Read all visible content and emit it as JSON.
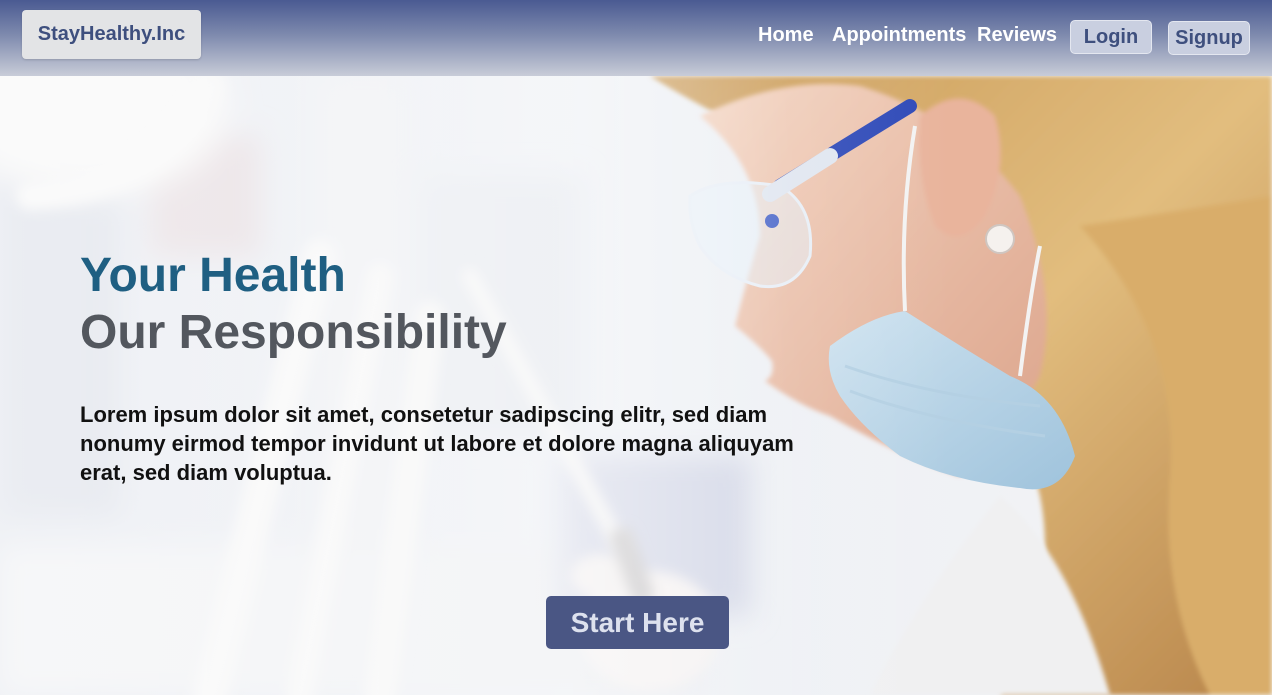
{
  "brand": {
    "name": "StayHealthy.Inc"
  },
  "nav": {
    "home": "Home",
    "appointments": "Appointments",
    "reviews": "Reviews",
    "login": "Login",
    "signup": "Signup"
  },
  "hero": {
    "headline_line1": "Your Health",
    "headline_line2": "Our Responsibility",
    "intro": "Lorem ipsum dolor sit amet, consetetur sadipscing elitr, sed diam nonumy eirmod tempor invidunt ut labore et dolore magna aliquyam erat, sed diam voluptua.",
    "cta_label": "Start Here",
    "photo_subject": "dentist-with-mask-and-goggles"
  },
  "colors": {
    "nav_gradient_top": "#4a5a92",
    "brand_text": "#3e4f7e",
    "headline_blue": "#1f5f82",
    "headline_gray": "#53575e",
    "cta_background": "#4a5684"
  }
}
